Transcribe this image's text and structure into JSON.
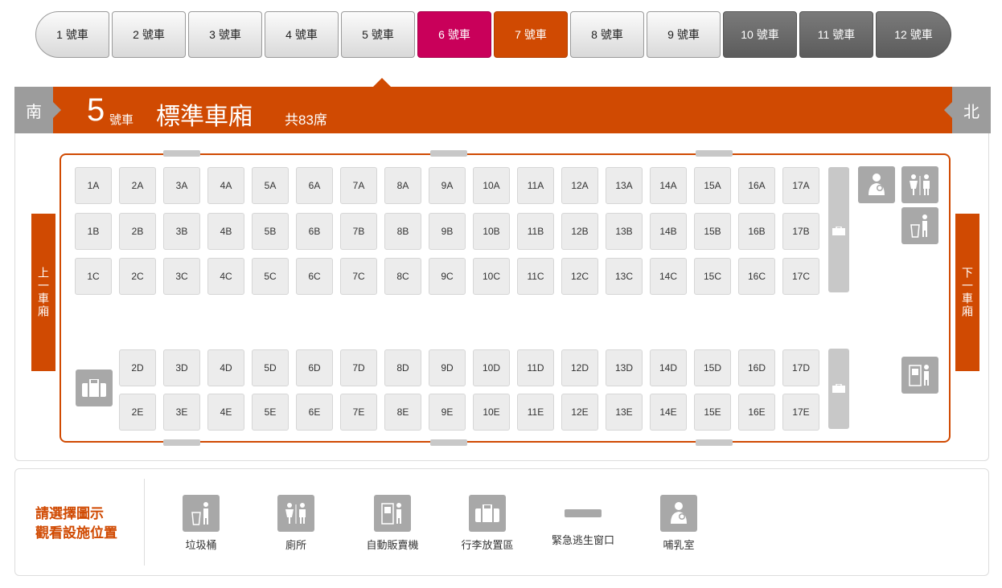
{
  "tabs": [
    "1 號車",
    "2 號車",
    "3 號車",
    "4 號車",
    "5 號車",
    "6 號車",
    "7 號車",
    "8 號車",
    "9 號車",
    "10 號車",
    "11 號車",
    "12 號車"
  ],
  "header": {
    "south": "南",
    "north": "北",
    "car_number": "5",
    "car_suffix": "號車",
    "car_type": "標準車廂",
    "seat_count": "共83席"
  },
  "nav": {
    "prev": "上一車廂",
    "next": "下一車廂"
  },
  "seats": {
    "rowA": [
      "1A",
      "2A",
      "3A",
      "4A",
      "5A",
      "6A",
      "7A",
      "8A",
      "9A",
      "10A",
      "11A",
      "12A",
      "13A",
      "14A",
      "15A",
      "16A",
      "17A"
    ],
    "rowB": [
      "1B",
      "2B",
      "3B",
      "4B",
      "5B",
      "6B",
      "7B",
      "8B",
      "9B",
      "10B",
      "11B",
      "12B",
      "13B",
      "14B",
      "15B",
      "16B",
      "17B"
    ],
    "rowC": [
      "1C",
      "2C",
      "3C",
      "4C",
      "5C",
      "6C",
      "7C",
      "8C",
      "9C",
      "10C",
      "11C",
      "12C",
      "13C",
      "14C",
      "15C",
      "16C",
      "17C"
    ],
    "rowD": [
      "2D",
      "3D",
      "4D",
      "5D",
      "6D",
      "7D",
      "8D",
      "9D",
      "10D",
      "11D",
      "12D",
      "13D",
      "14D",
      "15D",
      "16D",
      "17D"
    ],
    "rowE": [
      "2E",
      "3E",
      "4E",
      "5E",
      "6E",
      "7E",
      "8E",
      "9E",
      "10E",
      "11E",
      "12E",
      "13E",
      "14E",
      "15E",
      "16E",
      "17E"
    ]
  },
  "legend": {
    "prompt_line1": "請選擇圖示",
    "prompt_line2": "觀看設施位置",
    "items": [
      "垃圾桶",
      "廁所",
      "自動販賣機",
      "行李放置區",
      "緊急逃生窗口",
      "哺乳室"
    ]
  },
  "colors": {
    "accent": "#d04a02",
    "pink": "#c9005a",
    "icon_grey": "#a8a8a8"
  }
}
